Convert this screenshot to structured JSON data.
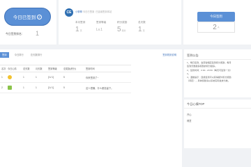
{
  "checkin": {
    "button_label": "今日已签到",
    "rank_label": "今日签到排名：",
    "rank_value": "1"
  },
  "user": {
    "avatar_text": "CE",
    "name": "小聊聊",
    "subtitle": "今日已签到",
    "extra": "已连续签到本站"
  },
  "stats": [
    {
      "label": "本月签到",
      "value": "1",
      "unit": "天"
    },
    {
      "label": "签到等级",
      "value": "Lv.1",
      "unit": ""
    },
    {
      "label": "积分奖励",
      "value": "5",
      "unit": "积分"
    },
    {
      "label": "总天数",
      "value": "1",
      "unit": "天"
    }
  ],
  "rate": {
    "button_label": "今日签到",
    "value": "2",
    "unit": "人"
  },
  "tabs": {
    "items": [
      "签到",
      "今日排行",
      "总天数排行"
    ],
    "right_link": "签到规则说明"
  },
  "table": {
    "headers": [
      "名次",
      "今日心情",
      "总天数",
      "月天数",
      "签到等级",
      "总奖励(积分)",
      "签到时间"
    ],
    "rows": [
      [
        "1",
        "",
        "1",
        "1",
        "[LV.1]",
        "5",
        "你来签到了~"
      ],
      [
        "2",
        "",
        "1",
        "1",
        "[LV.1]",
        "5",
        "这人很懒，什么都没留下。"
      ]
    ]
  },
  "notice": {
    "title": "签到公告",
    "lines": [
      "1、每日签到，会获得相应签到积分奖励，每月",
      "签到天数越多奖励的积分越多。",
      "2、签到时间：0:00 - 23:59（每天可签到一次）",
      "3、",
      "4、温馨提示：连续签到可以获得额外积分奖励",
      "（待定），具体奖励请以系统实际发放为准。"
    ]
  },
  "top": {
    "title": "今日心情TOP",
    "rows": [
      "开心",
      "得意"
    ]
  }
}
